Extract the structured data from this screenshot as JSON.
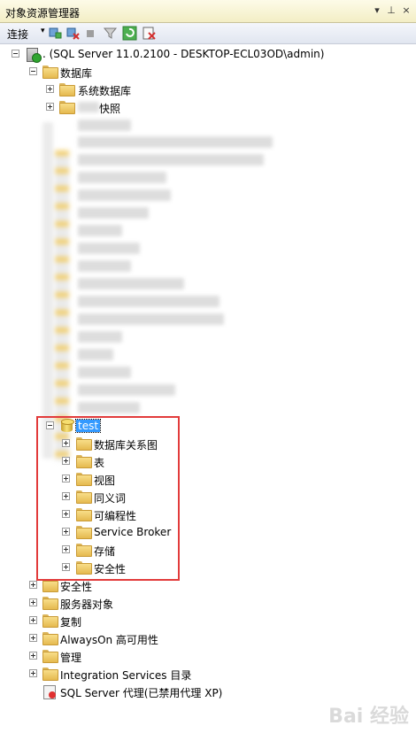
{
  "window": {
    "title": "对象资源管理器",
    "dropdown_glyph": "▾",
    "pin_glyph": "⊥",
    "close_glyph": "×"
  },
  "toolbar": {
    "connect_label": "连接",
    "connect_caret": "▾"
  },
  "tree": {
    "server_label": ". (SQL Server 11.0.2100 - DESKTOP-ECL03OD\\admin)",
    "databases_label": "数据库",
    "system_databases_label": "系统数据库",
    "snapshots_label": "快照",
    "test_db": {
      "label": "test",
      "children": [
        "数据库关系图",
        "表",
        "视图",
        "同义词",
        "可编程性",
        "Service Broker",
        "存储",
        "安全性"
      ]
    },
    "server_children": [
      "安全性",
      "服务器对象",
      "复制",
      "AlwaysOn 高可用性",
      "管理",
      "Integration Services 目录"
    ],
    "agent_label": "SQL Server 代理(已禁用代理 XP)"
  },
  "watermark": "Bai 经验"
}
